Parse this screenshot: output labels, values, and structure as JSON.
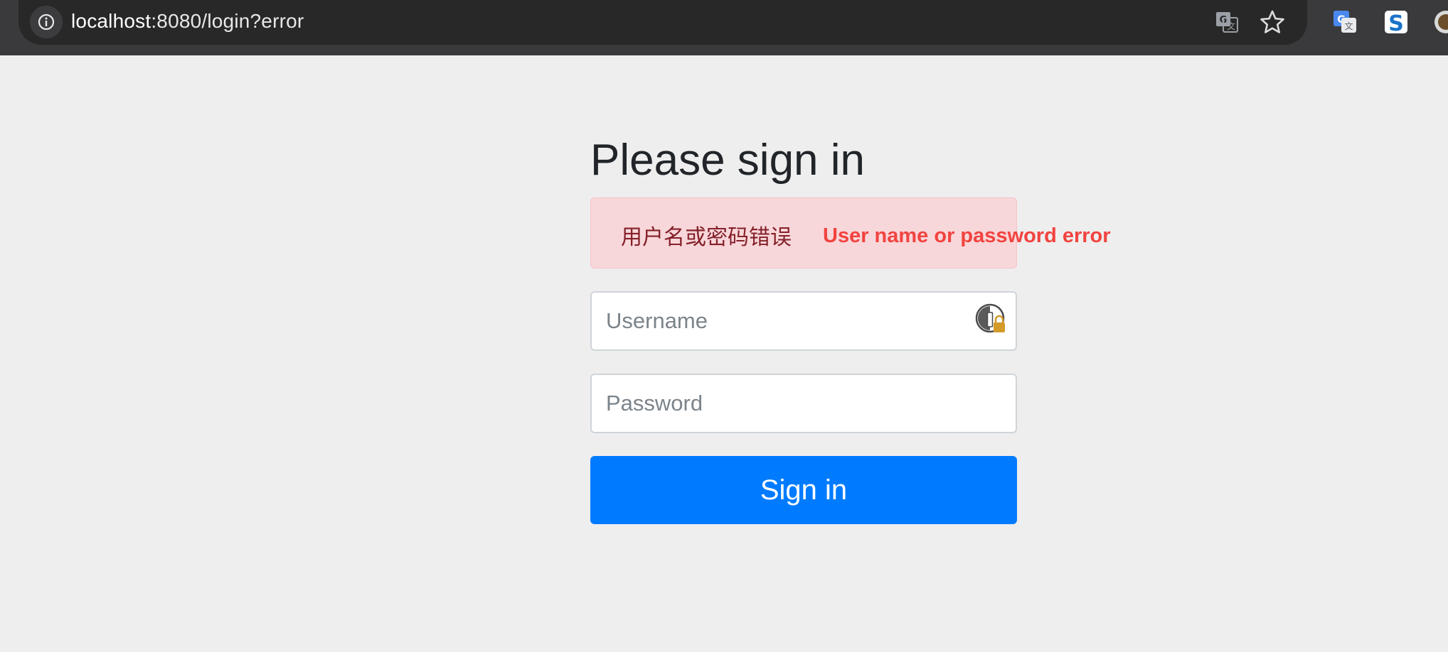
{
  "browser": {
    "url_host": "localhost",
    "url_rest": ":8080/login?error",
    "icons": [
      "info-icon",
      "translate-icon",
      "bookmark-star-icon",
      "google-translate-extension-icon",
      "s-extension-icon",
      "profile-icon"
    ]
  },
  "login": {
    "heading": "Please sign in",
    "error_message": "用户名或密码错误",
    "error_translation": "User name or password error",
    "username": {
      "value": "",
      "placeholder": "Username"
    },
    "password": {
      "value": "",
      "placeholder": "Password"
    },
    "submit_label": "Sign in"
  },
  "colors": {
    "primary": "#007bff",
    "alert_bg": "#f8d7da",
    "alert_text": "#842029",
    "annotation": "#f2433f",
    "page_bg": "#eeeeee"
  }
}
